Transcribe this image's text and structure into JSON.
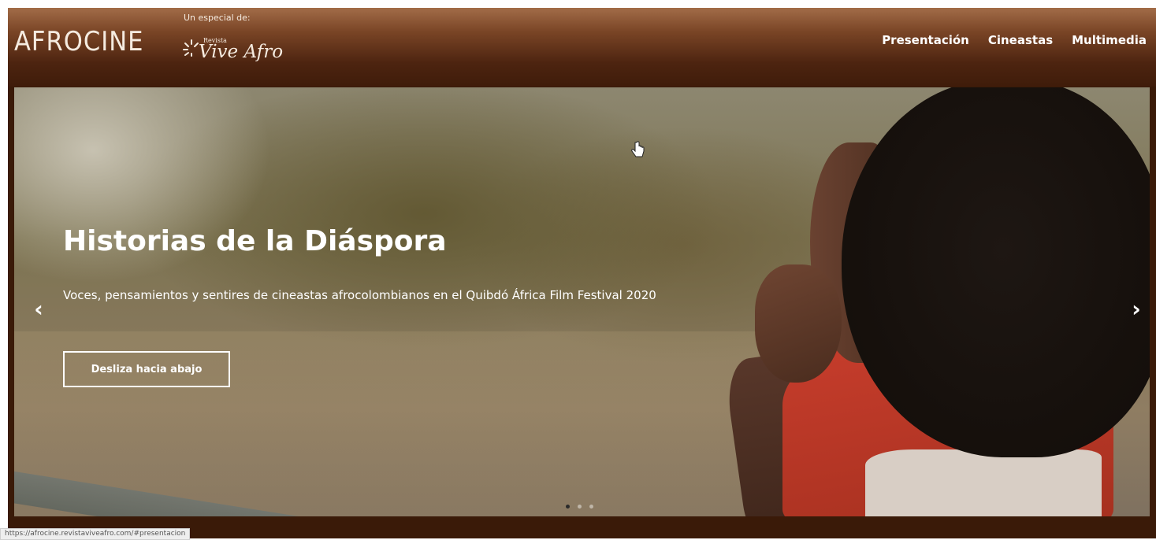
{
  "header": {
    "logo": "AFROCINE",
    "especial_label": "Un especial de:",
    "partner_small": "Revista",
    "partner_name": "Vive Afro",
    "nav": [
      "Presentación",
      "Cineastas",
      "Multimedia"
    ]
  },
  "hero": {
    "title": "Historias de la Diáspora",
    "subtitle": "Voces, pensamientos y sentires de cineastas afrocolombianos en el Quibdó África Film Festival 2020",
    "button": "Desliza hacia abajo",
    "prev_icon": "chevron-left-icon",
    "next_icon": "chevron-right-icon",
    "slides_total": 3,
    "active_slide": 1
  },
  "status_bar": {
    "url": "https://afrocine.revistaviveafro.com/#presentacion"
  },
  "colors": {
    "header_top": "#a26c48",
    "header_bottom": "#3f1c0a",
    "frame": "#3a1a08",
    "text": "#ffffff"
  }
}
